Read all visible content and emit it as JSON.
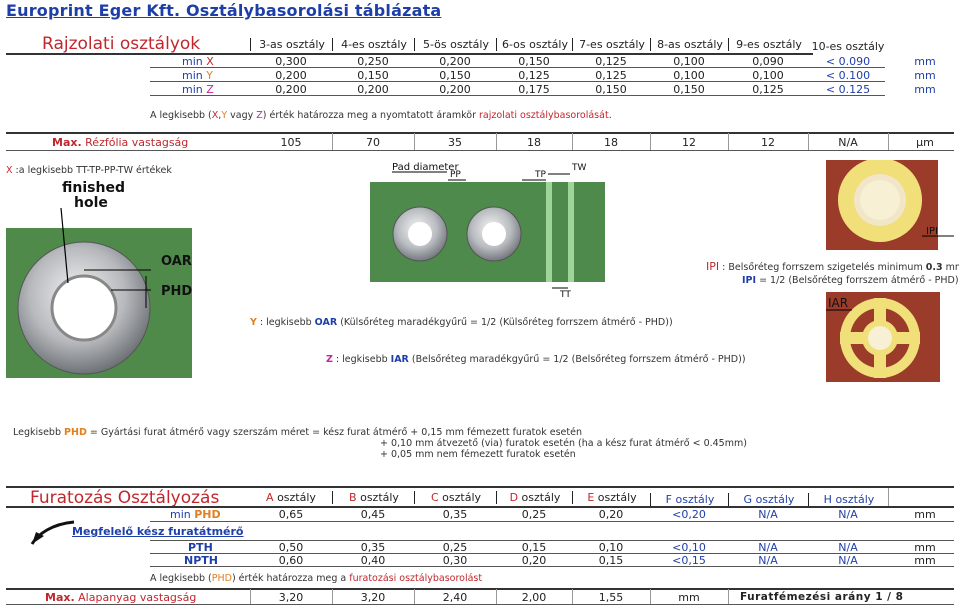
{
  "title": "Europrint Eger Kft. Osztálybasorolási táblázata",
  "rajzolati": {
    "heading": "Rajzolati osztályok",
    "columns": [
      "3-as osztály",
      "4-es osztály",
      "5-ös osztály",
      "6-os osztály",
      "7-es osztály",
      "8-as osztály",
      "9-es osztály",
      "10-es osztály"
    ],
    "rows": [
      {
        "prefix": "min ",
        "letter": "X",
        "values": [
          "0,300",
          "0,250",
          "0,200",
          "0,150",
          "0,125",
          "0,100",
          "0,090",
          "< 0.090"
        ],
        "unit": "mm"
      },
      {
        "prefix": "min ",
        "letter": "Y",
        "values": [
          "0,200",
          "0,150",
          "0,150",
          "0,125",
          "0,125",
          "0,100",
          "0,100",
          "< 0.100"
        ],
        "unit": "mm"
      },
      {
        "prefix": "min ",
        "letter": "Z",
        "values": [
          "0,200",
          "0,200",
          "0,200",
          "0,175",
          "0,150",
          "0,150",
          "0,125",
          "< 0.125"
        ],
        "unit": "mm"
      }
    ],
    "note_pre": "A legkisebb (",
    "note_x": "X",
    "note_comma": ",",
    "note_y": "Y",
    "note_mid": " vagy ",
    "note_z": "Z",
    "note_post": ") érték határozza meg a nyomtatott áramkör ",
    "note_link": "rajzolati osztálybasorolását",
    "note_end": "."
  },
  "rezfolia": {
    "label_max": "Max.",
    "label_rest": " Rézfólia vastagság",
    "values": [
      "105",
      "70",
      "35",
      "18",
      "18",
      "12",
      "12",
      "N/A"
    ],
    "unit": "µm"
  },
  "diagram": {
    "x_line_letter": "X",
    "x_line_text": " :a legkisebb TT-TP-PP-TW értékek",
    "photo1_labels": {
      "finished": "finished",
      "hole": "hole",
      "oar": "OAR",
      "phd": "PHD"
    },
    "photo2_labels": {
      "pad": "Pad diameter",
      "pp": "PP",
      "tp": "TP",
      "tw": "TW",
      "tt": "TT"
    },
    "photo3_label": "IPI",
    "photo4_label": "IAR",
    "ipi_letter": "IPI",
    "ipi_text": " : Belsőréteg forrszem szigetelés minimum ",
    "ipi_val": "0.3",
    "ipi_unit": " mm",
    "ipi_formula_letter": "IPI",
    "ipi_formula": " = 1/2 (Belsőréteg forrszem átmérő - PHD)",
    "y_letter": "Y",
    "y_text_pre": " : legkisebb ",
    "y_bold": "OAR",
    "y_text_post": " (Külsőréteg maradékgyűrű = 1/2 (Külsőréteg forrszem átmérő - PHD))",
    "z_letter": "Z",
    "z_text_pre": " : legkisebb ",
    "z_bold": "IAR",
    "z_text_post": " (Belsőréteg maradékgyűrű = 1/2 (Belsőréteg forrszem átmérő - PHD))"
  },
  "phd_note": {
    "pre": "Legkisebb ",
    "phd": "PHD",
    "line1": " = Gyártási furat átmérő vagy szerszám méret = kész furat átmérő + 0,15 mm fémezett furatok esetén",
    "line2": "+ 0,10 mm átvezető (via) furatok esetén (ha a kész furat átmérő < 0.45mm)",
    "line3": "+ 0,05 mm nem fémezett furatok esetén"
  },
  "furatozas": {
    "heading": "Furatozás Osztályozás",
    "columns": [
      {
        "letter": "A",
        "rest": " osztály"
      },
      {
        "letter": "B",
        "rest": " osztály"
      },
      {
        "letter": "C",
        "rest": " osztály"
      },
      {
        "letter": "D",
        "rest": " osztály"
      },
      {
        "letter": "E",
        "rest": " osztály"
      },
      {
        "letter": "F",
        "rest": " osztály"
      },
      {
        "letter": "G",
        "rest": " osztály"
      },
      {
        "letter": "H",
        "rest": " osztály"
      }
    ],
    "min_row": {
      "prefix": "min ",
      "label": "PHD",
      "values": [
        "0,65",
        "0,45",
        "0,35",
        "0,25",
        "0,20",
        "<0,20",
        "N/A",
        "N/A"
      ],
      "unit": "mm"
    },
    "arrow_label": "Megfelelő kész furatátmérő",
    "rows": [
      {
        "label": "PTH",
        "values": [
          "0,50",
          "0,35",
          "0,25",
          "0,15",
          "0,10",
          "<0,10",
          "N/A",
          "N/A"
        ],
        "unit": "mm"
      },
      {
        "label": "NPTH",
        "values": [
          "0,60",
          "0,40",
          "0,30",
          "0,20",
          "0,15",
          "<0,15",
          "N/A",
          "N/A"
        ],
        "unit": "mm"
      }
    ],
    "note_pre": "A legkisebb (",
    "note_phd": "PHD",
    "note_post": ") érték határozza meg a ",
    "note_link": "furatozási osztálybasorolást"
  },
  "alapanyag": {
    "label_max": "Max.",
    "label_rest": " Alapanyag vastagság",
    "values": [
      "3,20",
      "3,20",
      "2,40",
      "2,00",
      "1,55"
    ],
    "unit": "mm",
    "ratio_label": "Furatfémezési arány 1 / 8"
  }
}
